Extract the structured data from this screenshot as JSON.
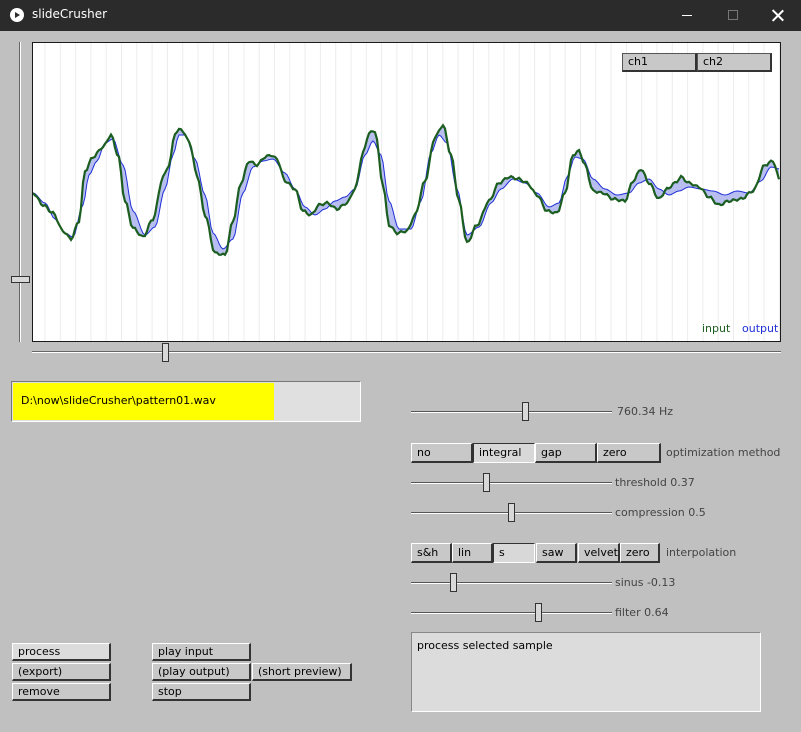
{
  "window": {
    "title": "slideCrusher",
    "minimize_glyph": "",
    "close_glyph": ""
  },
  "channels": [
    "ch1",
    "ch2"
  ],
  "legend": {
    "input": "input",
    "output": "output"
  },
  "colors": {
    "input": "#1b5e20",
    "output": "#1f2fd6",
    "fill": "#b8bff0",
    "file_fill": "#ffff00"
  },
  "file": {
    "path": "D:\\now\\slideCrusher\\pattern01.wav",
    "progress": 0.75
  },
  "frequency": {
    "label": "760.34 Hz",
    "level": 0.57
  },
  "optimization": {
    "label": "optimization method",
    "options": [
      "no",
      "integral",
      "gap",
      "zero"
    ],
    "selected": "integral"
  },
  "threshold": {
    "label": "threshold 0.37",
    "level": 0.37
  },
  "compression": {
    "label": "compression 0.5",
    "level": 0.5
  },
  "interpolation": {
    "label": "interpolation",
    "options": [
      "s&h",
      "lin",
      "s",
      "saw",
      "velvet",
      "zero"
    ],
    "selected": "s"
  },
  "sinus": {
    "label": "sinus -0.13",
    "level": 0.2
  },
  "filter": {
    "label": "filter 0.64",
    "level": 0.64
  },
  "buttons": {
    "process": "process",
    "export": "(export)",
    "remove": "remove",
    "play_input": "play input",
    "play_output": "(play output)",
    "short_preview": "(short preview)",
    "stop": "stop"
  },
  "status": "process selected sample"
}
